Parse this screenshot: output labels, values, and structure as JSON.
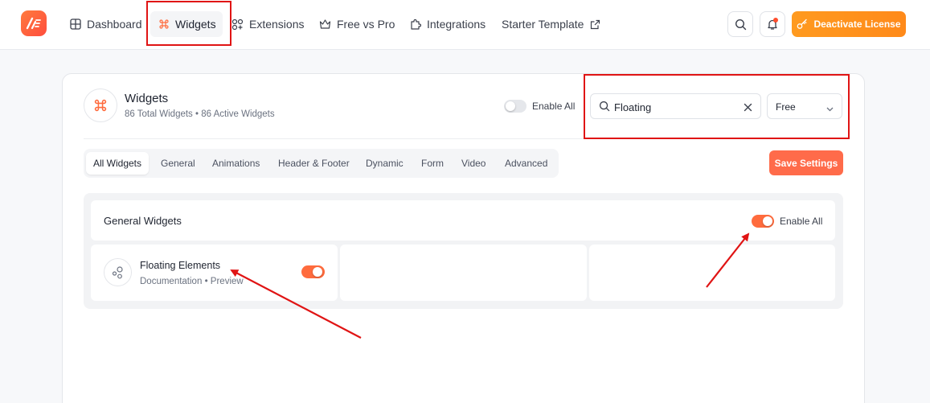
{
  "nav": {
    "items": [
      {
        "label": "Dashboard",
        "icon": "grid-icon"
      },
      {
        "label": "Widgets",
        "icon": "command-icon",
        "active": true
      },
      {
        "label": "Extensions",
        "icon": "extensions-icon"
      },
      {
        "label": "Free vs Pro",
        "icon": "crown-icon"
      },
      {
        "label": "Integrations",
        "icon": "puzzle-icon"
      },
      {
        "label": "Starter Template",
        "icon": "external-link-icon"
      }
    ],
    "deactivate_label": "Deactivate License"
  },
  "header": {
    "title": "Widgets",
    "subtitle": "86 Total Widgets • 86 Active Widgets",
    "enable_all_label": "Enable All"
  },
  "search": {
    "value": "Floating",
    "filter_value": "Free"
  },
  "tabs": [
    "All Widgets",
    "General",
    "Animations",
    "Header & Footer",
    "Dynamic",
    "Form",
    "Video",
    "Advanced"
  ],
  "save_label": "Save Settings",
  "group": {
    "title": "General Widgets",
    "enable_all_label": "Enable All",
    "widgets": [
      {
        "name": "Floating Elements",
        "doc_label": "Documentation",
        "separator": "•",
        "preview_label": "Preview",
        "enabled": true
      }
    ]
  },
  "colors": {
    "accent": "#ff6b3d",
    "deactivate": "#ff8a1a",
    "annotation": "#e01414"
  }
}
